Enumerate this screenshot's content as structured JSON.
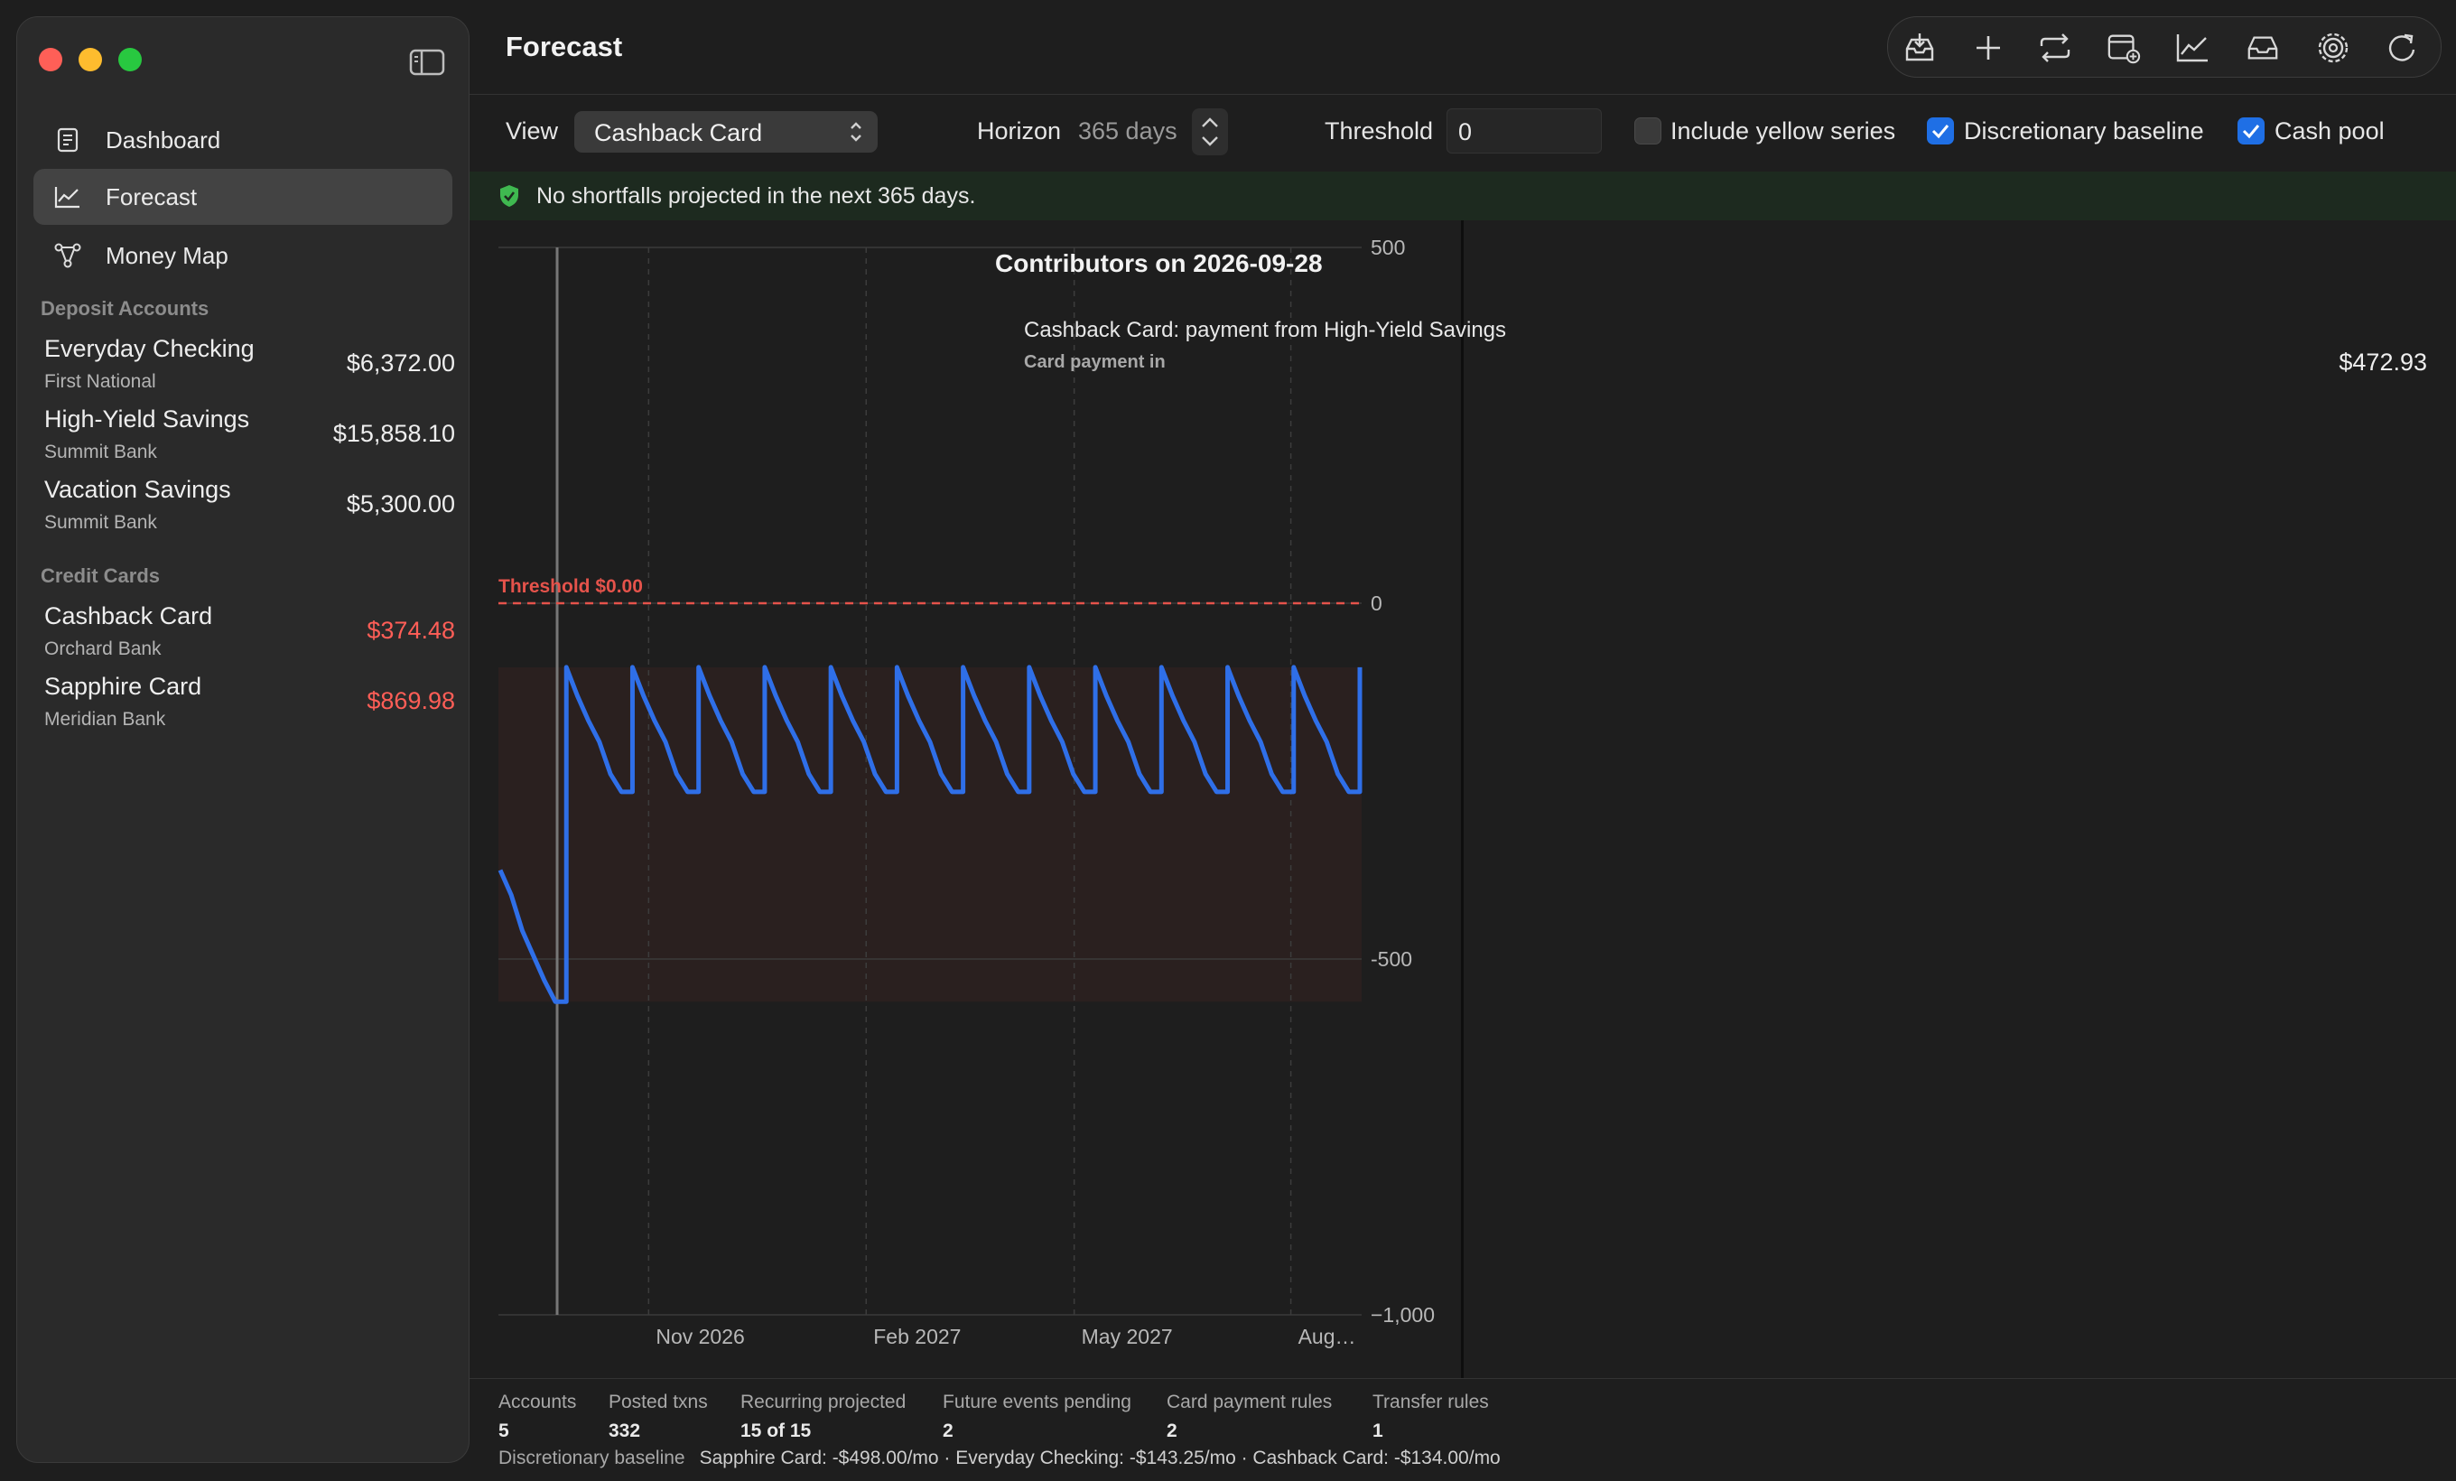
{
  "sidebar": {
    "nav": [
      {
        "label": "Dashboard",
        "icon": "dashboard-icon"
      },
      {
        "label": "Forecast",
        "icon": "chart-line-icon"
      },
      {
        "label": "Money Map",
        "icon": "network-icon"
      }
    ],
    "deposit_title": "Deposit Accounts",
    "deposits": [
      {
        "name": "Everyday Checking",
        "bank": "First National",
        "balance": "$6,372.00"
      },
      {
        "name": "High-Yield Savings",
        "bank": "Summit Bank",
        "balance": "$15,858.10"
      },
      {
        "name": "Vacation Savings",
        "bank": "Summit Bank",
        "balance": "$5,300.00"
      }
    ],
    "credit_title": "Credit Cards",
    "credits": [
      {
        "name": "Cashback Card",
        "bank": "Orchard Bank",
        "balance": "$374.48"
      },
      {
        "name": "Sapphire Card",
        "bank": "Meridian Bank",
        "balance": "$869.98"
      }
    ]
  },
  "header": {
    "title": "Forecast",
    "toolbar_icons": [
      "import-icon",
      "add-icon",
      "transfer-icon",
      "calendar-add-icon",
      "chart-icon",
      "inbox-icon",
      "settings-icon",
      "refresh-icon"
    ]
  },
  "filters": {
    "view_label": "View",
    "view_value": "Cashback Card",
    "horizon_label": "Horizon",
    "horizon_value": "365 days",
    "threshold_label": "Threshold",
    "threshold_value": "0",
    "yellow_label": "Include yellow series",
    "yellow_checked": false,
    "discretionary_label": "Discretionary baseline",
    "discretionary_checked": true,
    "cashpool_label": "Cash pool",
    "cashpool_checked": true
  },
  "banner": {
    "text": "No shortfalls projected in the next 365 days."
  },
  "chart_data": {
    "type": "line",
    "title": "",
    "ylim": [
      -1000,
      500
    ],
    "y_ticks": [
      "500",
      "0",
      "-500",
      "−1,000"
    ],
    "x_ticks": [
      "Nov 2026",
      "Feb 2027",
      "May 2027",
      "Aug…"
    ],
    "threshold_label": "Threshold $0.00",
    "threshold_value": 0,
    "band": [
      -560,
      -90
    ],
    "series_color": "#2f6fe8",
    "series": [
      {
        "values": [
          -375,
          -410,
          -460,
          -495,
          -530,
          -560,
          -90,
          -130,
          -165,
          -195,
          -240,
          -265,
          -90,
          -130,
          -165,
          -195,
          -240,
          -265,
          -90,
          -130,
          -165,
          -195,
          -240,
          -265,
          -90,
          -130,
          -165,
          -195,
          -240,
          -265,
          -90,
          -130,
          -165,
          -195,
          -240,
          -265,
          -90,
          -130,
          -165,
          -195,
          -240,
          -265,
          -90,
          -130,
          -165,
          -195,
          -240,
          -265,
          -90,
          -130,
          -165,
          -195,
          -240,
          -265,
          -90,
          -130,
          -165,
          -195,
          -240,
          -265,
          -90,
          -130,
          -165,
          -195,
          -240,
          -265,
          -90,
          -130,
          -165,
          -195,
          -240,
          -265,
          -90,
          -130,
          -165,
          -195,
          -240,
          -265,
          -90
        ]
      }
    ]
  },
  "contributors": {
    "title": "Contributors on 2026-09-28",
    "items": [
      {
        "name": "Cashback Card: payment from High-Yield Savings",
        "sub": "Card payment in",
        "amount": "$472.93"
      }
    ]
  },
  "stats": [
    {
      "label": "Accounts",
      "value": "5"
    },
    {
      "label": "Posted txns",
      "value": "332"
    },
    {
      "label": "Recurring projected",
      "value": "15 of 15"
    },
    {
      "label": "Future events pending",
      "value": "2"
    },
    {
      "label": "Card payment rules",
      "value": "2"
    },
    {
      "label": "Transfer rules",
      "value": "1"
    }
  ],
  "baseline": {
    "label": "Discretionary baseline",
    "text": "Sapphire Card: -$498.00/mo · Everyday Checking: -$143.25/mo · Cashback Card: -$134.00/mo"
  }
}
